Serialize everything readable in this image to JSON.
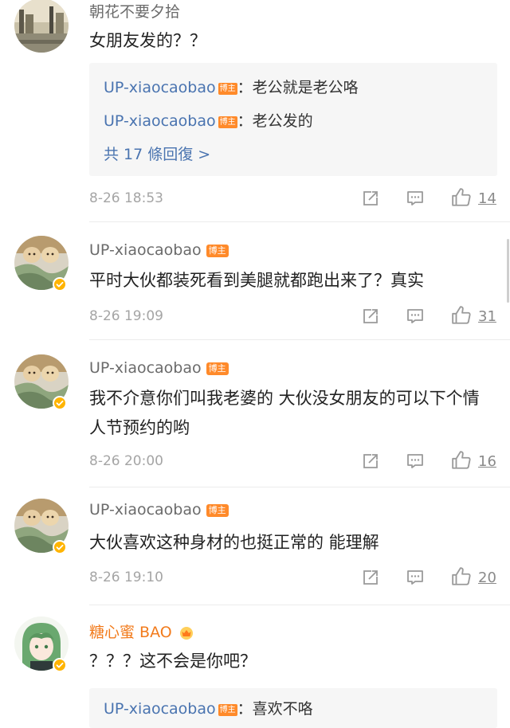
{
  "comments": [
    {
      "username": "朝花不要夕拾",
      "text": "女朋友发的？？",
      "replies": [
        {
          "user": "UP-xiaocaobao",
          "tag": "博主",
          "text": "：老公就是老公咯"
        },
        {
          "user": "UP-xiaocaobao",
          "tag": "博主",
          "text": "：老公发的"
        }
      ],
      "more_replies": "共 17 條回復 >",
      "time": "8-26 18:53",
      "likes": "14"
    },
    {
      "username": "UP-xiaocaobao",
      "tag": "博主",
      "text": "平时大伙都装死看到美腿就都跑出来了？真实",
      "time": "8-26 19:09",
      "likes": "31"
    },
    {
      "username": "UP-xiaocaobao",
      "tag": "博主",
      "text": "我不介意你们叫我老婆的 大伙没女朋友的可以下个情人节预约的哟",
      "time": "8-26 20:00",
      "likes": "16"
    },
    {
      "username": "UP-xiaocaobao",
      "tag": "博主",
      "text": "大伙喜欢这种身材的也挺正常的 能理解",
      "time": "8-26 19:10",
      "likes": "20"
    },
    {
      "username": "糖心蜜 BAO",
      "text": "？？？这不会是你吧？",
      "replies": [
        {
          "user": "UP-xiaocaobao",
          "tag": "博主",
          "text": "：喜欢不咯"
        }
      ]
    }
  ],
  "colors": {
    "link_blue": "#4a74b0",
    "tag_orange": "#ff8a2a",
    "vip_orange": "#f27b1c",
    "verified_yellow": "#ffb400"
  },
  "icons": {
    "share": "share-icon",
    "comment": "comment-icon",
    "like": "like-icon",
    "verified": "verified-badge-icon",
    "vip": "vip-crown-icon"
  }
}
